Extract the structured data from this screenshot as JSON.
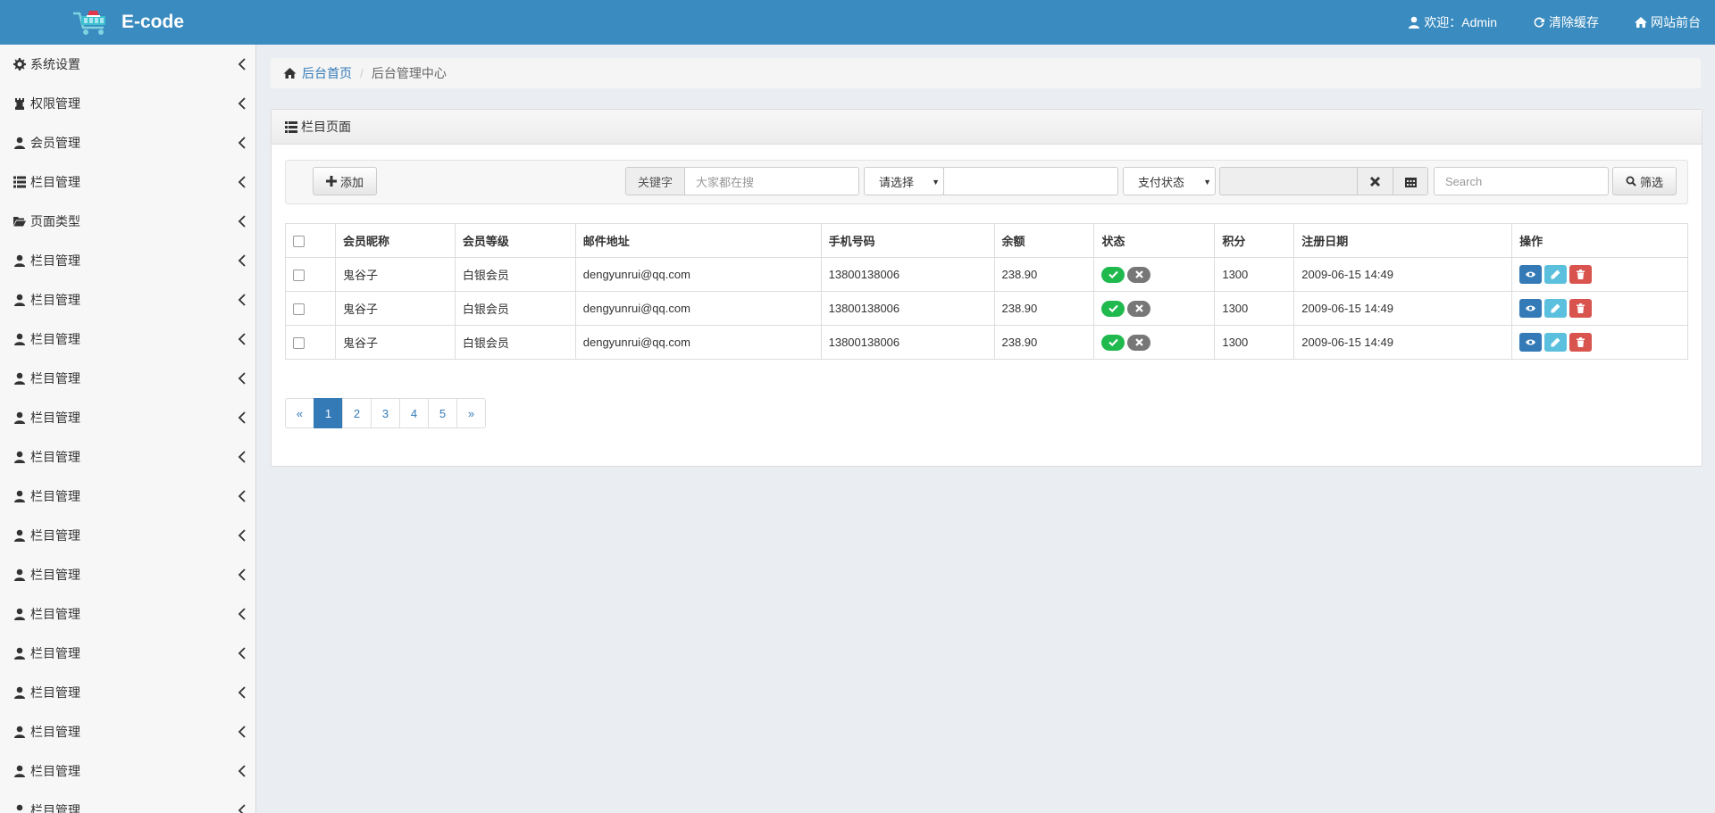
{
  "header": {
    "app_title": "E-code",
    "welcome": "欢迎：Admin",
    "clear_cache": "清除缓存",
    "site_front": "网站前台"
  },
  "sidebar": {
    "items": [
      {
        "label": "系统设置",
        "icon": "gear-icon"
      },
      {
        "label": "权限管理",
        "icon": "chess-rook-icon"
      },
      {
        "label": "会员管理",
        "icon": "user-icon"
      },
      {
        "label": "栏目管理",
        "icon": "list-icon"
      },
      {
        "label": "页面类型",
        "icon": "folder-open-icon"
      },
      {
        "label": "栏目管理",
        "icon": "user-icon"
      },
      {
        "label": "栏目管理",
        "icon": "user-icon"
      },
      {
        "label": "栏目管理",
        "icon": "user-icon"
      },
      {
        "label": "栏目管理",
        "icon": "user-icon"
      },
      {
        "label": "栏目管理",
        "icon": "user-icon"
      },
      {
        "label": "栏目管理",
        "icon": "user-icon"
      },
      {
        "label": "栏目管理",
        "icon": "user-icon"
      },
      {
        "label": "栏目管理",
        "icon": "user-icon"
      },
      {
        "label": "栏目管理",
        "icon": "user-icon"
      },
      {
        "label": "栏目管理",
        "icon": "user-icon"
      },
      {
        "label": "栏目管理",
        "icon": "user-icon"
      },
      {
        "label": "栏目管理",
        "icon": "user-icon"
      },
      {
        "label": "栏目管理",
        "icon": "user-icon"
      },
      {
        "label": "栏目管理",
        "icon": "user-icon"
      },
      {
        "label": "栏目管理",
        "icon": "user-icon"
      }
    ]
  },
  "breadcrumb": {
    "home": "后台首页",
    "current": "后台管理中心"
  },
  "panel": {
    "title": "栏目页面"
  },
  "toolbar": {
    "add_label": "添加",
    "keyword_label": "关键字",
    "keyword_placeholder": "大家都在搜",
    "select_value": "请选择",
    "pay_status": "支付状态",
    "search_placeholder": "Search",
    "filter_label": "筛选"
  },
  "table": {
    "headers": [
      "会员昵称",
      "会员等级",
      "邮件地址",
      "手机号码",
      "余额",
      "状态",
      "积分",
      "注册日期",
      "操作"
    ],
    "rows": [
      {
        "nickname": "鬼谷子",
        "level": "白银会员",
        "email": "dengyunrui@qq.com",
        "phone": "13800138006",
        "balance": "238.90",
        "points": "1300",
        "date": "2009-06-15 14:49"
      },
      {
        "nickname": "鬼谷子",
        "level": "白银会员",
        "email": "dengyunrui@qq.com",
        "phone": "13800138006",
        "balance": "238.90",
        "points": "1300",
        "date": "2009-06-15 14:49"
      },
      {
        "nickname": "鬼谷子",
        "level": "白银会员",
        "email": "dengyunrui@qq.com",
        "phone": "13800138006",
        "balance": "238.90",
        "points": "1300",
        "date": "2009-06-15 14:49"
      }
    ]
  },
  "pagination": {
    "prev": "«",
    "pages": [
      "1",
      "2",
      "3",
      "4",
      "5"
    ],
    "next": "»",
    "active": "1"
  },
  "colors": {
    "topbar": "#3a8bbf",
    "primary": "#337ab7",
    "success": "#1fb94e",
    "muted": "#777777",
    "info": "#5bc0de",
    "danger": "#d9534f"
  }
}
